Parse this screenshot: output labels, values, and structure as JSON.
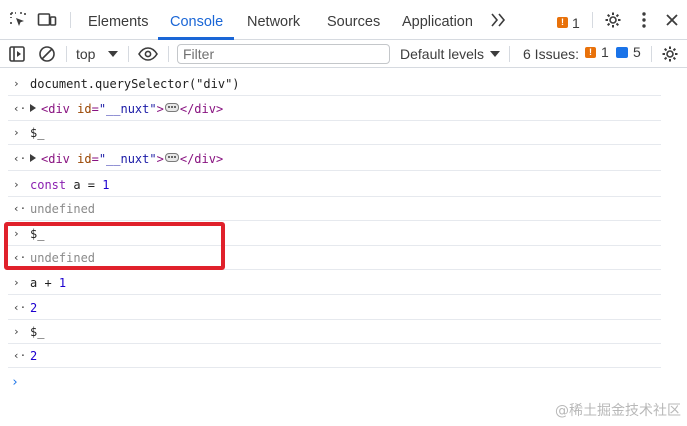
{
  "tabs": [
    {
      "label": "Elements"
    },
    {
      "label": "Console"
    },
    {
      "label": "Network"
    },
    {
      "label": "Sources"
    },
    {
      "label": "Application"
    }
  ],
  "tabbar": {
    "issue_count": "1"
  },
  "toolbar": {
    "context": "top",
    "filter_placeholder": "Filter",
    "levels": "Default levels",
    "issues_label": "6 Issues:",
    "warn_count": "1",
    "info_count": "5"
  },
  "console": {
    "rows": [
      {
        "dir": "in",
        "text": "document.querySelector(\"div\")"
      },
      {
        "dir": "out",
        "element": {
          "open": "<div ",
          "attr": "id",
          "eq": "=",
          "value": "\"__nuxt\"",
          "close": ">",
          "end": "</div>"
        }
      },
      {
        "dir": "in",
        "text": "$_"
      },
      {
        "dir": "out",
        "element": {
          "open": "<div ",
          "attr": "id",
          "eq": "=",
          "value": "\"__nuxt\"",
          "close": ">",
          "end": "</div>"
        }
      },
      {
        "dir": "in",
        "kw": "const",
        "rest": " a = ",
        "num": "1"
      },
      {
        "dir": "out",
        "text": "undefined"
      },
      {
        "dir": "in",
        "text": "$_"
      },
      {
        "dir": "out",
        "text": "undefined"
      },
      {
        "dir": "in",
        "rest": "a + ",
        "num": "1"
      },
      {
        "dir": "out",
        "text": "2"
      },
      {
        "dir": "in",
        "text": "$_"
      },
      {
        "dir": "out",
        "text": "2"
      }
    ],
    "arrow_in": "›",
    "arrow_out": "‹·",
    "prompt": "›"
  },
  "watermark": "@稀土掘金技术社区",
  "colors": {
    "accent": "#1a66d6",
    "highlight": "#e0212b",
    "warn": "#e8710a",
    "info": "#1a73e8"
  }
}
